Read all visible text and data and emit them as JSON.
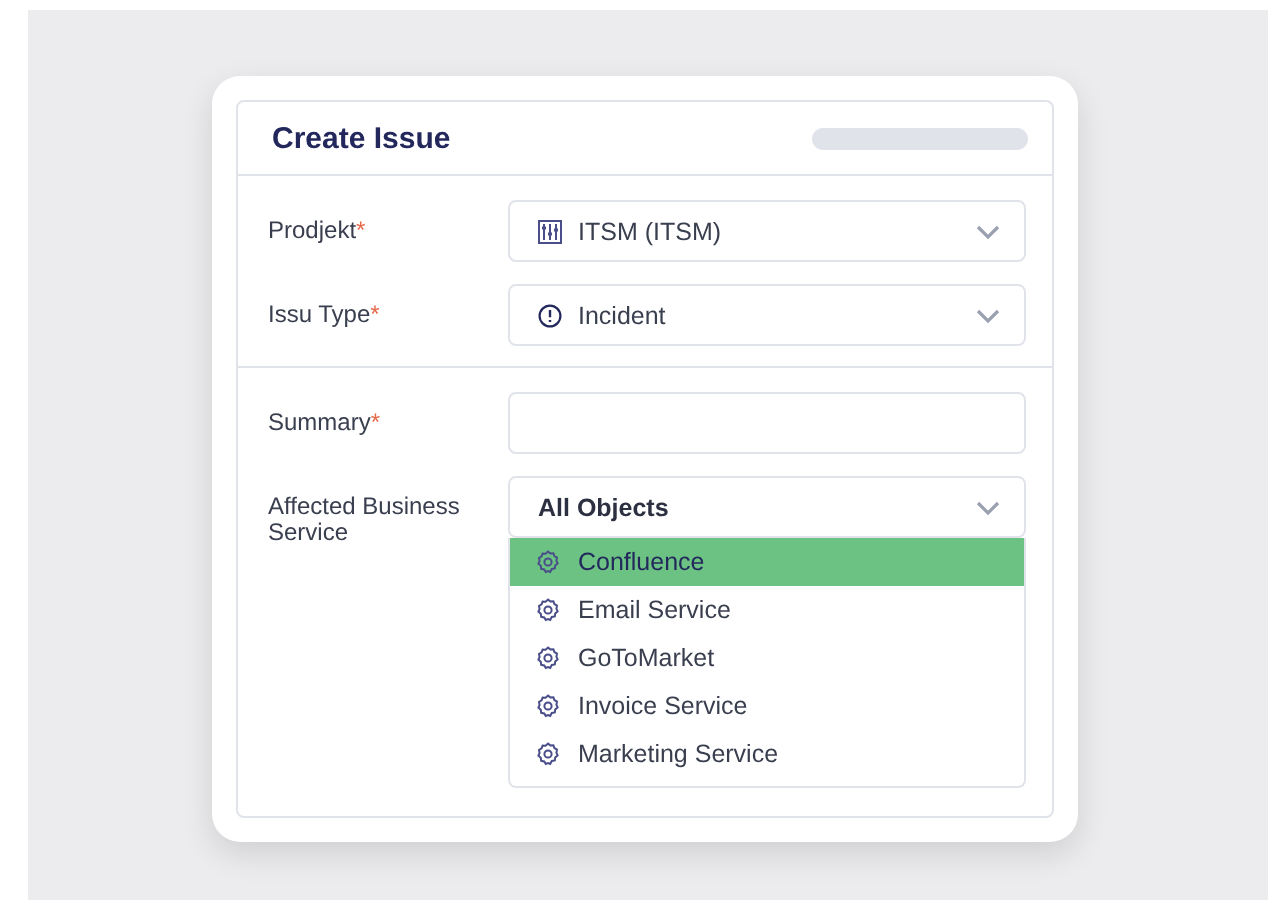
{
  "dialog": {
    "title": "Create Issue"
  },
  "sections": [
    {
      "fields": [
        {
          "kind": "select",
          "label": "Prodjekt",
          "required_mark": "*",
          "value": "ITSM (ITSM)"
        },
        {
          "kind": "select",
          "label": "Issu Type",
          "required_mark": "*",
          "value": "Incident"
        }
      ]
    },
    {
      "fields": [
        {
          "kind": "text",
          "label": "Summary",
          "required_mark": "*"
        },
        {
          "kind": "lookup",
          "label": "Affected Business Service",
          "value": "All Objects",
          "expanded": true,
          "options": [
            {
              "label": "Confluence",
              "selected": true
            },
            {
              "label": "Email Service",
              "selected": false
            },
            {
              "label": "GoToMarket",
              "selected": false
            },
            {
              "label": "Invoice Service",
              "selected": false
            },
            {
              "label": "Marketing Service",
              "selected": false
            }
          ]
        }
      ]
    }
  ]
}
